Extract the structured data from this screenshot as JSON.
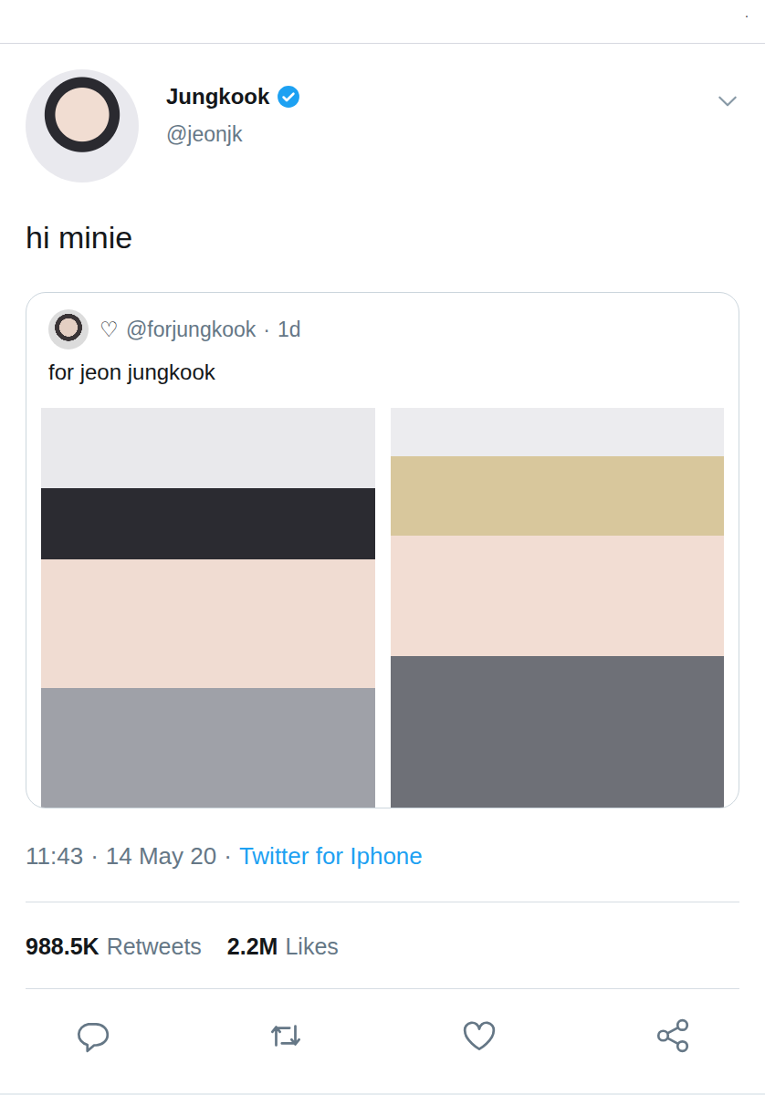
{
  "top_mark": ".",
  "tweet": {
    "name": "Jungkook",
    "handle": "@jeonjk",
    "verified": true,
    "text": "hi minie"
  },
  "quoted": {
    "heart": "♡",
    "handle": "@forjungkook",
    "separator": "·",
    "age": "1d",
    "text": "for jeon jungkook"
  },
  "meta": {
    "time": "11:43",
    "separator1": "·",
    "date": "14 May 20",
    "separator2": "·",
    "source": "Twitter for Iphone"
  },
  "stats": [
    {
      "count": "988.5K",
      "label": "Retweets"
    },
    {
      "count": "2.2M",
      "label": "Likes"
    }
  ]
}
